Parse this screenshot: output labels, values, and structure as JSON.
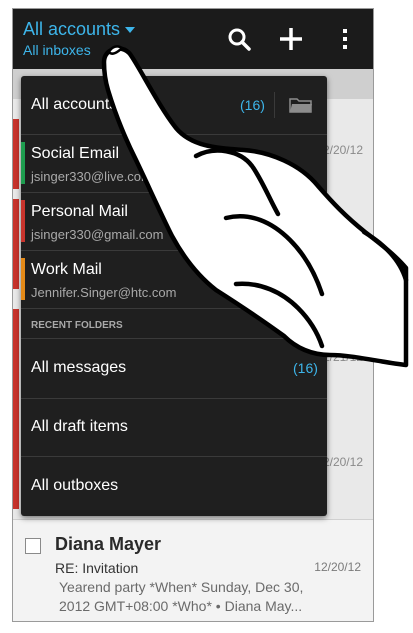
{
  "header": {
    "title": "All accounts",
    "subtitle": "All inboxes"
  },
  "dropdown": {
    "all_accounts": {
      "label": "All accounts",
      "count": "(16)"
    },
    "accounts": [
      {
        "name": "Social Email",
        "address": "jsinger330@live.com",
        "color": "#1e9d4f"
      },
      {
        "name": "Personal Mail",
        "address": "jsinger330@gmail.com",
        "color": "#c8342d"
      },
      {
        "name": "Work Mail",
        "address": "Jennifer.Singer@htc.com",
        "color": "#e48a18"
      }
    ],
    "recent_header": "RECENT FOLDERS",
    "folders": [
      {
        "label": "All messages",
        "count": "(16)"
      },
      {
        "label": "All draft items"
      },
      {
        "label": "All outboxes"
      }
    ]
  },
  "background_dates": [
    "12/20/12",
    "12/21/12",
    "12/20/12"
  ],
  "email": {
    "sender": "Diana Mayer",
    "subject": "RE: Invitation",
    "date": "12/20/12",
    "preview": "Yearend party *When* Sunday, Dec 30, 2012 GMT+08:00 *Who* • Diana May..."
  },
  "colors": {
    "accent": "#3db5ea",
    "topbar": "#1b1b1b",
    "dropdown": "#1f1f1f"
  }
}
